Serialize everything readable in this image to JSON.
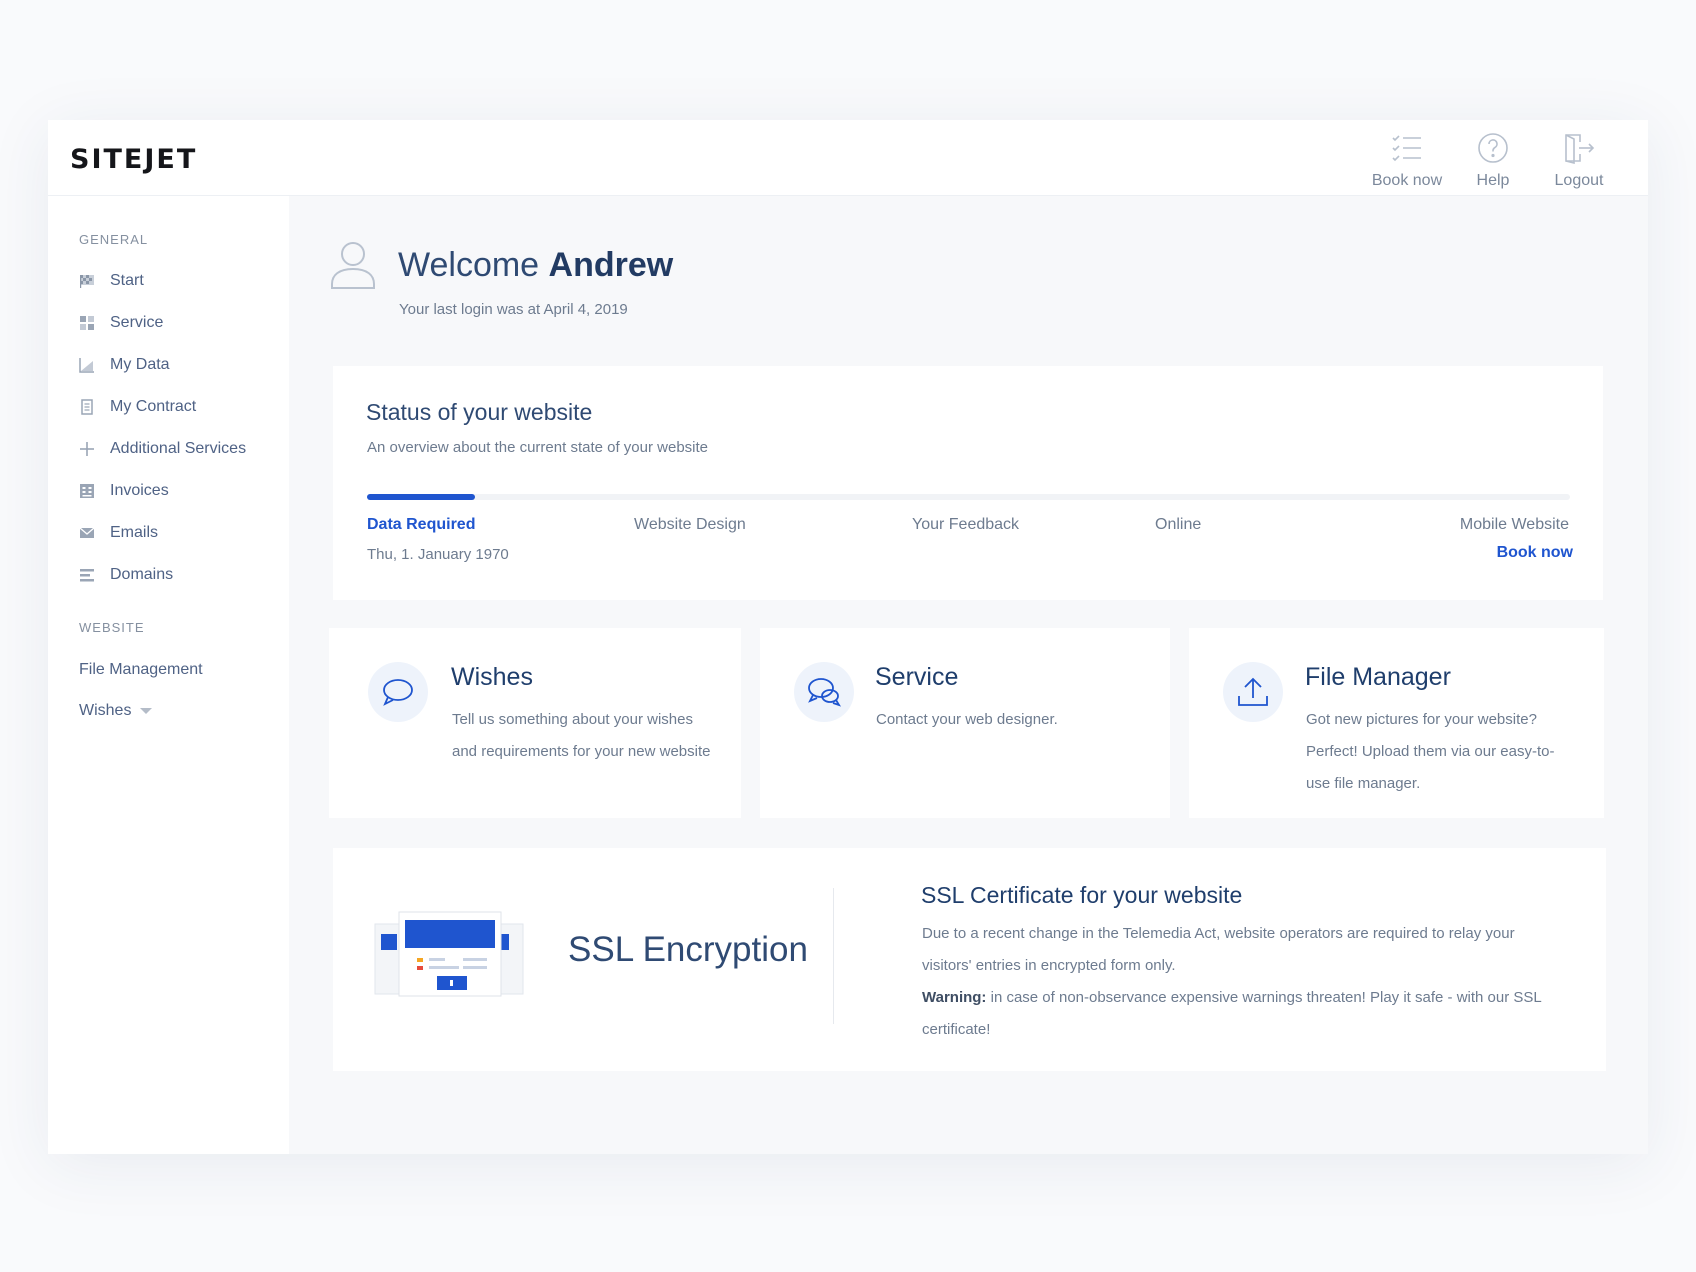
{
  "brand": {
    "logo": "SITEJET"
  },
  "header": {
    "actions": [
      {
        "label": "Book now",
        "icon": "checklist-icon"
      },
      {
        "label": "Help",
        "icon": "help-circle-icon"
      },
      {
        "label": "Logout",
        "icon": "logout-door-icon"
      }
    ]
  },
  "sidebar": {
    "general_label": "GENERAL",
    "items": [
      {
        "label": "Start",
        "icon": "flag-icon"
      },
      {
        "label": "Service",
        "icon": "service-grid-icon"
      },
      {
        "label": "My Data",
        "icon": "chart-icon"
      },
      {
        "label": "My Contract",
        "icon": "document-icon"
      },
      {
        "label": "Additional Services",
        "icon": "plus-icon"
      },
      {
        "label": "Invoices",
        "icon": "invoice-icon"
      },
      {
        "label": "Emails",
        "icon": "envelope-icon"
      },
      {
        "label": "Domains",
        "icon": "list-icon"
      }
    ],
    "website_label": "WEBSITE",
    "website_items": [
      {
        "label": "File Management"
      },
      {
        "label": "Wishes"
      }
    ]
  },
  "welcome": {
    "greeting": "Welcome",
    "name": "Andrew",
    "last_login": "Your last login was at April 4, 2019"
  },
  "status": {
    "title": "Status of your website",
    "subtitle": "An overview about the current state of your website",
    "progress": 0.09,
    "steps": [
      "Data Required",
      "Website Design",
      "Your Feedback",
      "Online",
      "Mobile Website"
    ],
    "date": "Thu, 1. January 1970",
    "book_now": "Book now"
  },
  "features": [
    {
      "title": "Wishes",
      "desc": "Tell us something about your wishes and requirements for your new website",
      "icon": "chat-bubble-icon"
    },
    {
      "title": "Service",
      "desc": "Contact your web designer.",
      "icon": "chat-bubbles-icon"
    },
    {
      "title": "File Manager",
      "desc": "Got new pictures for your website? Perfect! Upload them via our easy-to-use file manager.",
      "icon": "upload-icon"
    }
  ],
  "ssl": {
    "title": "SSL Encryption",
    "heading": "SSL Certificate for your website",
    "text": "Due to a recent change in the Telemedia Act, website operators are required to relay your visitors' entries in encrypted form only.",
    "warning_label": "Warning:",
    "warning_text": " in case of non-observance expensive warnings threaten! Play it safe - with our SSL certificate!"
  },
  "colors": {
    "accent": "#1f55cf",
    "heading": "#2f4a73",
    "text": "#6d7b8f"
  }
}
